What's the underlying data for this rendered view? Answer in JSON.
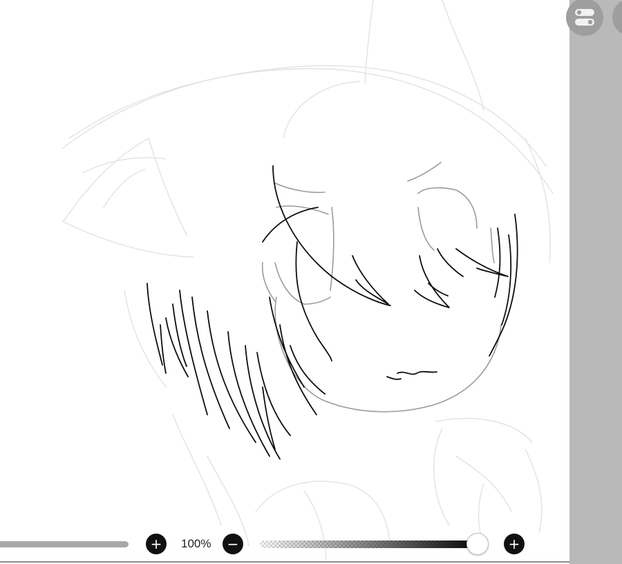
{
  "toolbar": {
    "zoom_label": "100%",
    "size_plus_glyph": "+",
    "zoom_minus_glyph": "−",
    "opacity_plus_glyph": "+",
    "brush_opacity": 0.97
  },
  "icons": {
    "layers_toggle": "toggle-switches-icon",
    "secondary": "panel-icon"
  },
  "colors": {
    "panel": "#b9b9b9",
    "button": "#9e9e9e",
    "ink": "#111111",
    "sketch": "#dcdcdc"
  }
}
